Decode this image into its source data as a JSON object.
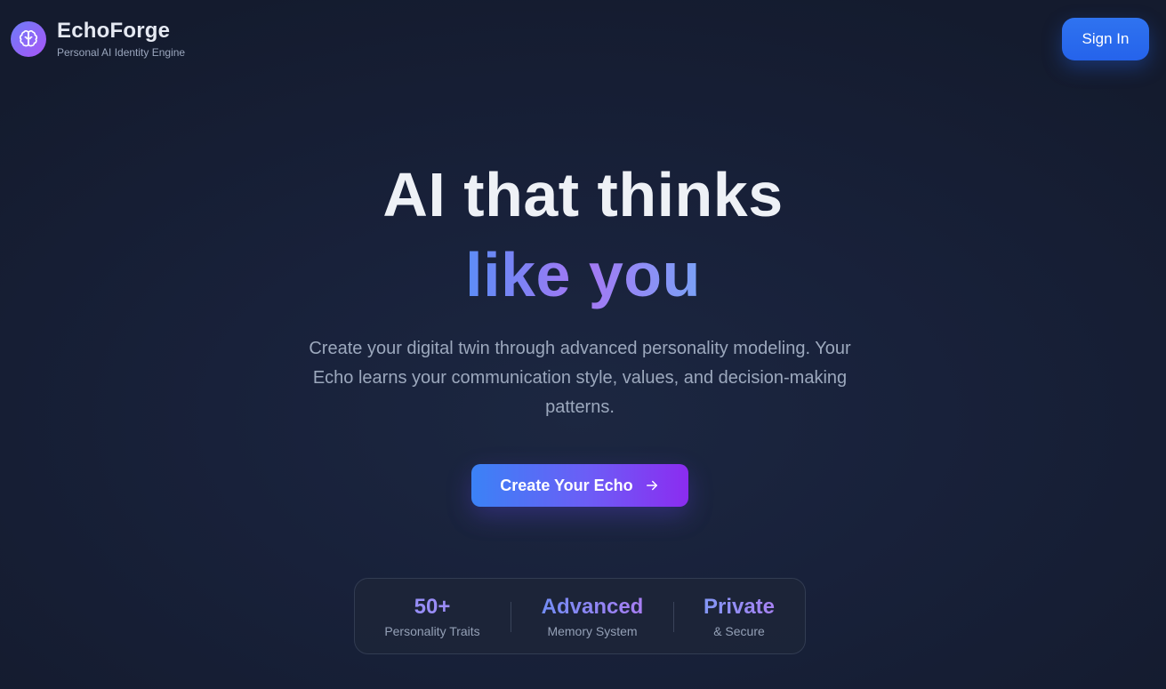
{
  "brand": {
    "name": "EchoForge",
    "tagline": "Personal AI Identity Engine",
    "icon": "brain-icon"
  },
  "header": {
    "signin_label": "Sign In"
  },
  "hero": {
    "title_line1": "AI that thinks",
    "title_line2": "like you",
    "subtitle": "Create your digital twin through advanced personality modeling. Your Echo learns your communication style, values, and decision-making patterns.",
    "cta_label": "Create Your Echo",
    "cta_icon": "arrow-right-icon"
  },
  "stats": [
    {
      "value": "50+",
      "label": "Personality Traits"
    },
    {
      "value": "Advanced",
      "label": "Memory System"
    },
    {
      "value": "Private",
      "label": "& Secure"
    }
  ],
  "colors": {
    "accent_blue": "#2563eb",
    "accent_purple": "#8b2cf0",
    "background": "#18213a"
  }
}
